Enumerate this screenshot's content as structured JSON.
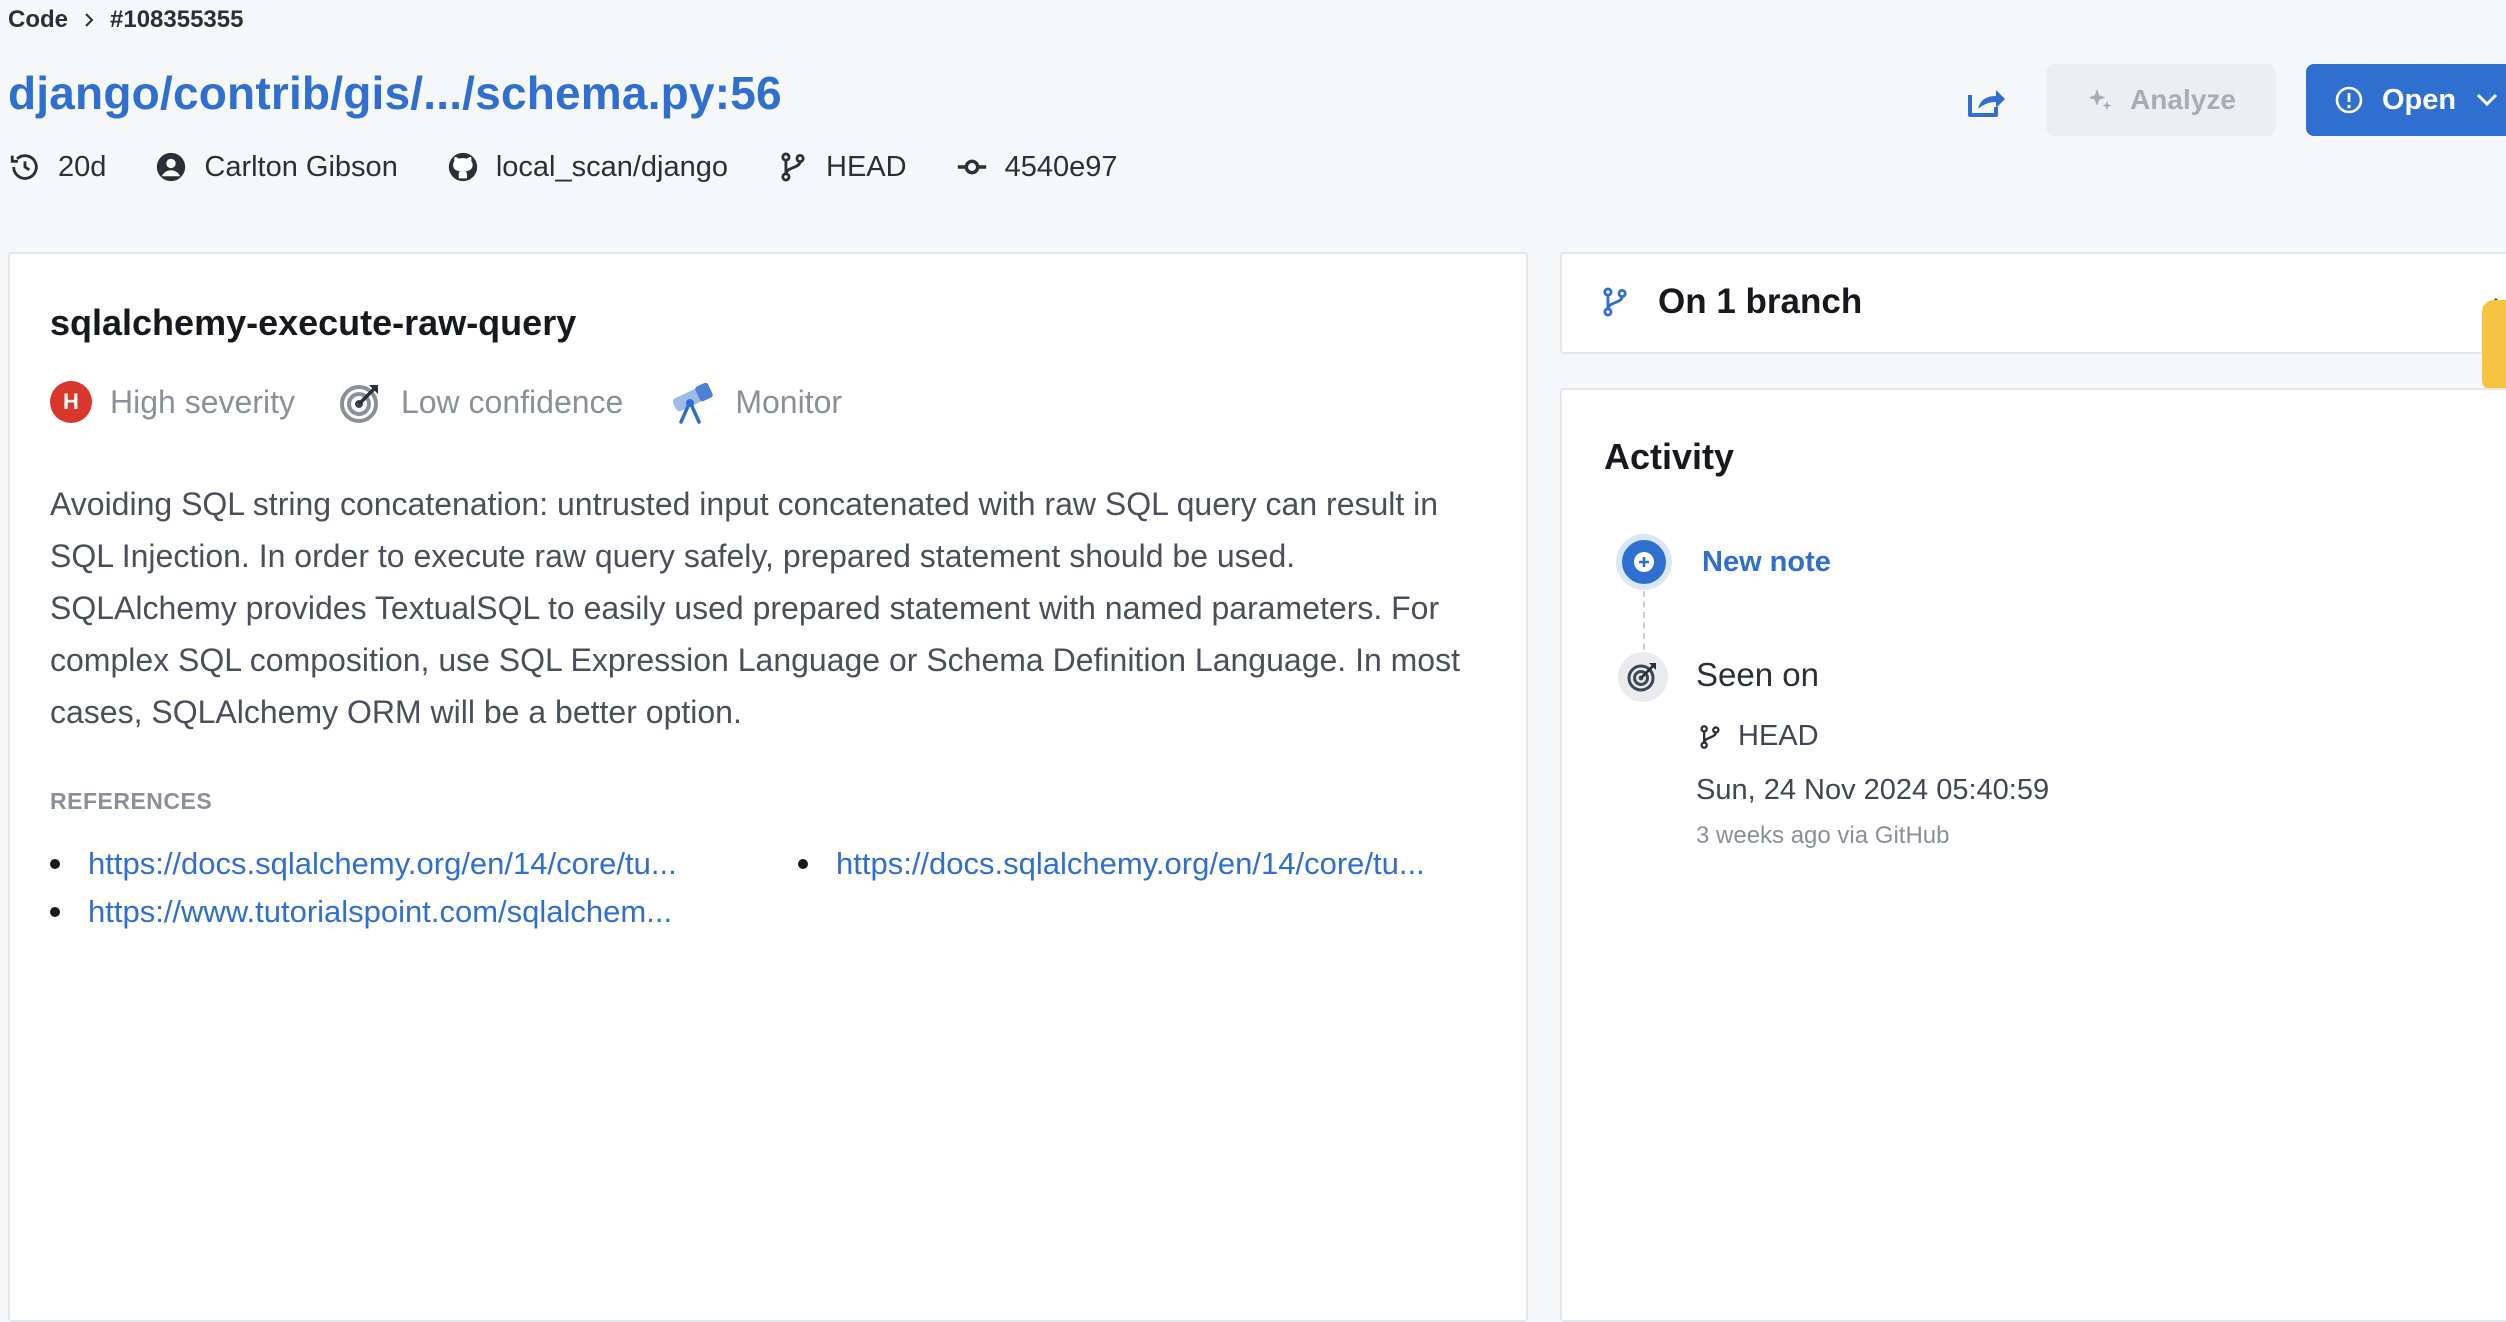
{
  "breadcrumb": {
    "root": "Code",
    "id": "#108355355"
  },
  "finding": {
    "title": "django/contrib/gis/.../schema.py:56",
    "age": "20d",
    "author": "Carlton Gibson",
    "repo": "local_scan/django",
    "branch": "HEAD",
    "commit": "4540e97"
  },
  "actions": {
    "analyze_label": "Analyze",
    "open_label": "Open"
  },
  "rule": {
    "name": "sqlalchemy-execute-raw-query",
    "severity_badge": "H",
    "severity": "High severity",
    "confidence": "Low confidence",
    "mode": "Monitor",
    "description": "Avoiding SQL string concatenation: untrusted input concatenated with raw SQL query can result in SQL Injection. In order to execute raw query safely, prepared statement should be used. SQLAlchemy provides TextualSQL to easily used prepared statement with named parameters. For complex SQL composition, use SQL Expression Language or Schema Definition Language. In most cases, SQLAlchemy ORM will be a better option.",
    "references_title": "REFERENCES",
    "references": [
      "https://docs.sqlalchemy.org/en/14/core/tu...",
      "https://docs.sqlalchemy.org/en/14/core/tu...",
      "https://www.tutorialspoint.com/sqlalchem..."
    ]
  },
  "branches": {
    "label": "On 1 branch"
  },
  "activity": {
    "title": "Activity",
    "new_note": "New note",
    "seen_title": "Seen on",
    "seen_branch": "HEAD",
    "seen_date": "Sun, 24 Nov 2024 05:40:59",
    "seen_ago": "3 weeks ago via GitHub"
  },
  "colors": {
    "accent": "#2f6fcf",
    "severity_high": "#d9372b",
    "warning_tab": "#f6c343"
  }
}
